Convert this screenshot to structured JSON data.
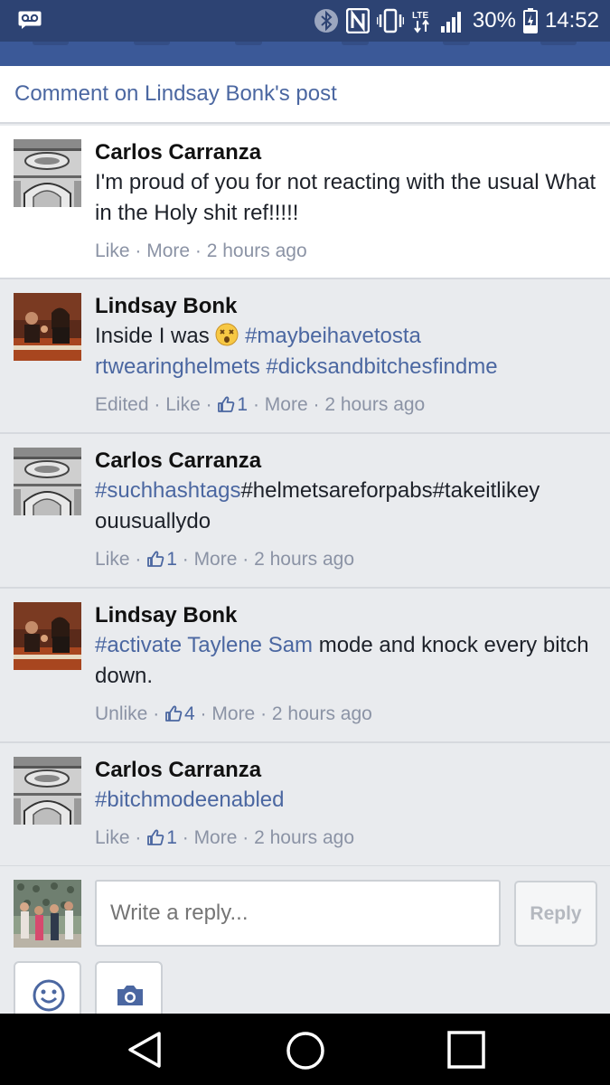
{
  "status_bar": {
    "battery": "30%",
    "time": "14:52",
    "network": "LTE",
    "icons": [
      "voicemail-icon",
      "bluetooth-icon",
      "nfc-icon",
      "vibrate-icon",
      "lte-icon",
      "signal-icon",
      "battery-charging-icon"
    ]
  },
  "header": {
    "title": "Comment on Lindsay Bonk's post"
  },
  "comments": [
    {
      "author": "Carlos Carranza",
      "text": "I'm proud of you for not reacting with the usual What in the Holy shit ref!!!!!",
      "like_label": "Like",
      "likes": "",
      "more_label": "More",
      "time": "2 hours ago",
      "avatar": "building-arch-avatar"
    },
    {
      "author": "Lindsay Bonk",
      "text_before": "Inside I was",
      "emoji": "dizzy-face-emoji",
      "tags": "#maybeihavetostartwearinghelmets #dicksandbitchesfindme",
      "tag_line1": "#maybeihavetosta",
      "tag_line2": "rtwearinghelmets #dicksandbitchesfindme",
      "edited_label": "Edited",
      "like_label": "Like",
      "likes": "1",
      "more_label": "More",
      "time": "2 hours ago",
      "avatar": "group-photo-avatar"
    },
    {
      "author": "Carlos Carranza",
      "tag": "#suchhashtags",
      "text_line1": "#helmetsareforpabs#takeitlikey",
      "text_line2": "ouusuallydo",
      "like_label": "Like",
      "likes": "1",
      "more_label": "More",
      "time": "2 hours ago",
      "avatar": "building-arch-avatar"
    },
    {
      "author": "Lindsay Bonk",
      "tag": "#activate",
      "mention": "Taylene Sam",
      "text": "mode and knock every bitch down.",
      "like_label": "Unlike",
      "likes": "4",
      "more_label": "More",
      "time": "2 hours ago",
      "avatar": "group-photo-avatar"
    },
    {
      "author": "Carlos Carranza",
      "tag": "#bitchmodeenabled",
      "like_label": "Like",
      "likes": "1",
      "more_label": "More",
      "time": "2 hours ago",
      "avatar": "building-arch-avatar"
    }
  ],
  "reply": {
    "placeholder": "Write a reply...",
    "button_label": "Reply",
    "tools": [
      "smiley-icon",
      "camera-icon"
    ]
  },
  "android_nav": [
    "back-icon",
    "home-icon",
    "recents-icon"
  ],
  "colors": {
    "status_bar": "#2d4373",
    "brand_blue": "#3b5998",
    "link": "#4b67a1",
    "meta": "#8b93a5",
    "background": "#e9ebee"
  }
}
